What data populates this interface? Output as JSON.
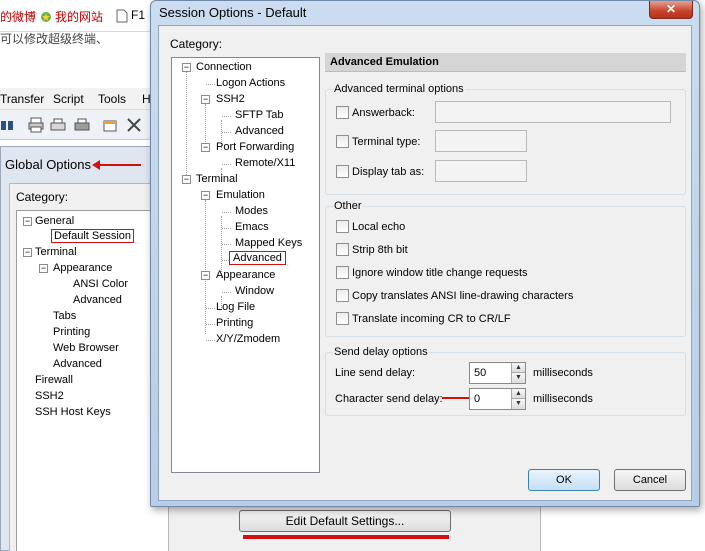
{
  "background": {
    "favorites": [
      {
        "label": "的微博",
        "icon": "weibo-icon"
      },
      {
        "label": "我的网站",
        "icon": "star-icon"
      },
      {
        "label": "F1",
        "icon": "page-icon"
      }
    ],
    "cjk_line": "可以修改超级终端、",
    "menu": [
      "Transfer",
      "Script",
      "Tools",
      "H"
    ],
    "global_options": {
      "title": "Global Options",
      "category_label": "Category:",
      "tree": [
        {
          "label": "General",
          "level": 0,
          "toggle": "−"
        },
        {
          "label": "Default Session",
          "level": 1,
          "highlighted": true
        },
        {
          "label": "Terminal",
          "level": 0,
          "toggle": "−"
        },
        {
          "label": "Appearance",
          "level": 1,
          "toggle": "−"
        },
        {
          "label": "ANSI Color",
          "level": 2
        },
        {
          "label": "Advanced",
          "level": 2
        },
        {
          "label": "Tabs",
          "level": 1
        },
        {
          "label": "Printing",
          "level": 1
        },
        {
          "label": "Web Browser",
          "level": 1
        },
        {
          "label": "Advanced",
          "level": 1
        },
        {
          "label": "Firewall",
          "level": 0
        },
        {
          "label": "SSH2",
          "level": 0
        },
        {
          "label": "SSH Host Keys",
          "level": 0
        }
      ]
    },
    "edit_default_button": "Edit Default Settings..."
  },
  "dialog": {
    "title": "Session Options - Default",
    "close_label": "✕",
    "category_label": "Category:",
    "tree": [
      {
        "label": "Connection",
        "level": 0,
        "toggle": "−"
      },
      {
        "label": "Logon Actions",
        "level": 1
      },
      {
        "label": "SSH2",
        "level": 1,
        "toggle": "−"
      },
      {
        "label": "SFTP Tab",
        "level": 2
      },
      {
        "label": "Advanced",
        "level": 2
      },
      {
        "label": "Port Forwarding",
        "level": 1,
        "toggle": "−"
      },
      {
        "label": "Remote/X11",
        "level": 2
      },
      {
        "label": "Terminal",
        "level": 0,
        "toggle": "−"
      },
      {
        "label": "Emulation",
        "level": 1,
        "toggle": "−"
      },
      {
        "label": "Modes",
        "level": 2
      },
      {
        "label": "Emacs",
        "level": 2
      },
      {
        "label": "Mapped Keys",
        "level": 2
      },
      {
        "label": "Advanced",
        "level": 2,
        "highlighted": true
      },
      {
        "label": "Appearance",
        "level": 1,
        "toggle": "−"
      },
      {
        "label": "Window",
        "level": 2
      },
      {
        "label": "Log File",
        "level": 1
      },
      {
        "label": "Printing",
        "level": 1
      },
      {
        "label": "X/Y/Zmodem",
        "level": 1
      }
    ],
    "pane_title": "Advanced Emulation",
    "adv_terminal": {
      "title": "Advanced terminal options",
      "options": [
        {
          "label": "Answerback:",
          "checked": false
        },
        {
          "label": "Terminal type:",
          "checked": false
        },
        {
          "label": "Display tab as:",
          "checked": false
        }
      ]
    },
    "other": {
      "title": "Other",
      "options": [
        {
          "label": "Local echo",
          "checked": false
        },
        {
          "label": "Strip 8th bit",
          "checked": false
        },
        {
          "label": "Ignore window title change requests",
          "checked": false
        },
        {
          "label": "Copy translates ANSI line-drawing characters",
          "checked": false
        },
        {
          "label": "Translate incoming CR to CR/LF",
          "checked": false
        }
      ]
    },
    "send_delay": {
      "title": "Send delay options",
      "line_label": "Line send delay:",
      "line_value": "50",
      "char_label": "Character send delay:",
      "char_value": "0",
      "unit": "milliseconds"
    },
    "ok_label": "OK",
    "cancel_label": "Cancel"
  }
}
